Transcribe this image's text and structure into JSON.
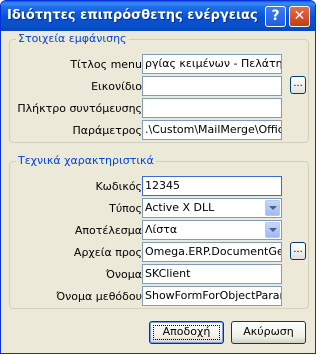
{
  "window": {
    "title": "Ιδιότητες επιπρόσθετης ενέργειας",
    "help_label": "?",
    "close_label": "✕"
  },
  "appearance": {
    "title": "Στοιχεία εμφάνισης",
    "menu_title_label": "Τίτλος menu",
    "menu_title_value": "ργίας κειμένων - Πελάτης",
    "icon_label": "Εικονίδιο",
    "icon_value": "",
    "icon_browse": "...",
    "shortcut_label": "Πλήκτρο συντόμευσης",
    "shortcut_value": "",
    "params_label": "Παράμετρος",
    "params_value": ".\\Custom\\MailMerge\\Office"
  },
  "technical": {
    "title": "Τεχνικά χαρακτηριστικά",
    "code_label": "Κωδικός",
    "code_value": "12345",
    "type_label": "Τύπος",
    "type_value": "Active X DLL",
    "result_label": "Αποτέλεσμα",
    "result_value": "Λίστα",
    "files_label": "Αρχεία προς",
    "files_value": "Omega.ERP.DocumentGen",
    "files_browse": "...",
    "name_label": "Όνομα",
    "name_value": "SKClient",
    "method_label": "Όνομα μεθόδου",
    "method_value": "ShowFormForObjectParams"
  },
  "buttons": {
    "ok": "Αποδοχή",
    "cancel": "Ακύρωση"
  }
}
